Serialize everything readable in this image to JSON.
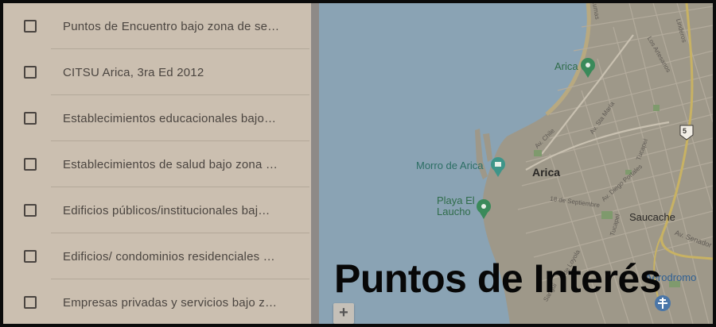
{
  "layers": [
    {
      "label": "Puntos de Encuentro bajo zona de se…",
      "checked": false
    },
    {
      "label": "CITSU Arica, 3ra Ed 2012",
      "checked": false
    },
    {
      "label": "Establecimientos educacionales bajo…",
      "checked": false
    },
    {
      "label": "Establecimientos de salud bajo zona …",
      "checked": false
    },
    {
      "label": "Edificios públicos/institucionales baj…",
      "checked": false
    },
    {
      "label": "Edificios/ condominios residenciales …",
      "checked": false
    },
    {
      "label": "Empresas privadas y servicios bajo z…",
      "checked": false
    }
  ],
  "map": {
    "places": {
      "arica_poi": "Arica",
      "arica_city": "Arica",
      "morro": "Morro de Arica",
      "playa_line1": "Playa El",
      "playa_line2": "Laucho",
      "saucache": "Saucache",
      "aerodromo": "Aerodromo"
    },
    "streets": {
      "lumas": "Lumas",
      "linderos": "Linderos",
      "los_artesanos": "Los Artesanos",
      "av_sta_maria": "Av. Sta María",
      "av_chile": "Av. Chile",
      "tucapel_1": "Tucapel",
      "tucapel_2": "Tucapel",
      "av_diego_portales": "Av. Diego Portales",
      "dieciocho_sept": "18 de Septiembre",
      "av_senador": "Av. Senador",
      "loyola": "de Loyola",
      "sangui": "Sangui"
    },
    "route_shield": "5",
    "zoom_in_label": "+",
    "colors": {
      "sea": "#8aa3b4",
      "land": "#9e9889",
      "green_poi": "#3a8a5a",
      "teal_poi": "#3e9589",
      "highway": "#c8b263"
    }
  },
  "title": "Puntos de Interés"
}
